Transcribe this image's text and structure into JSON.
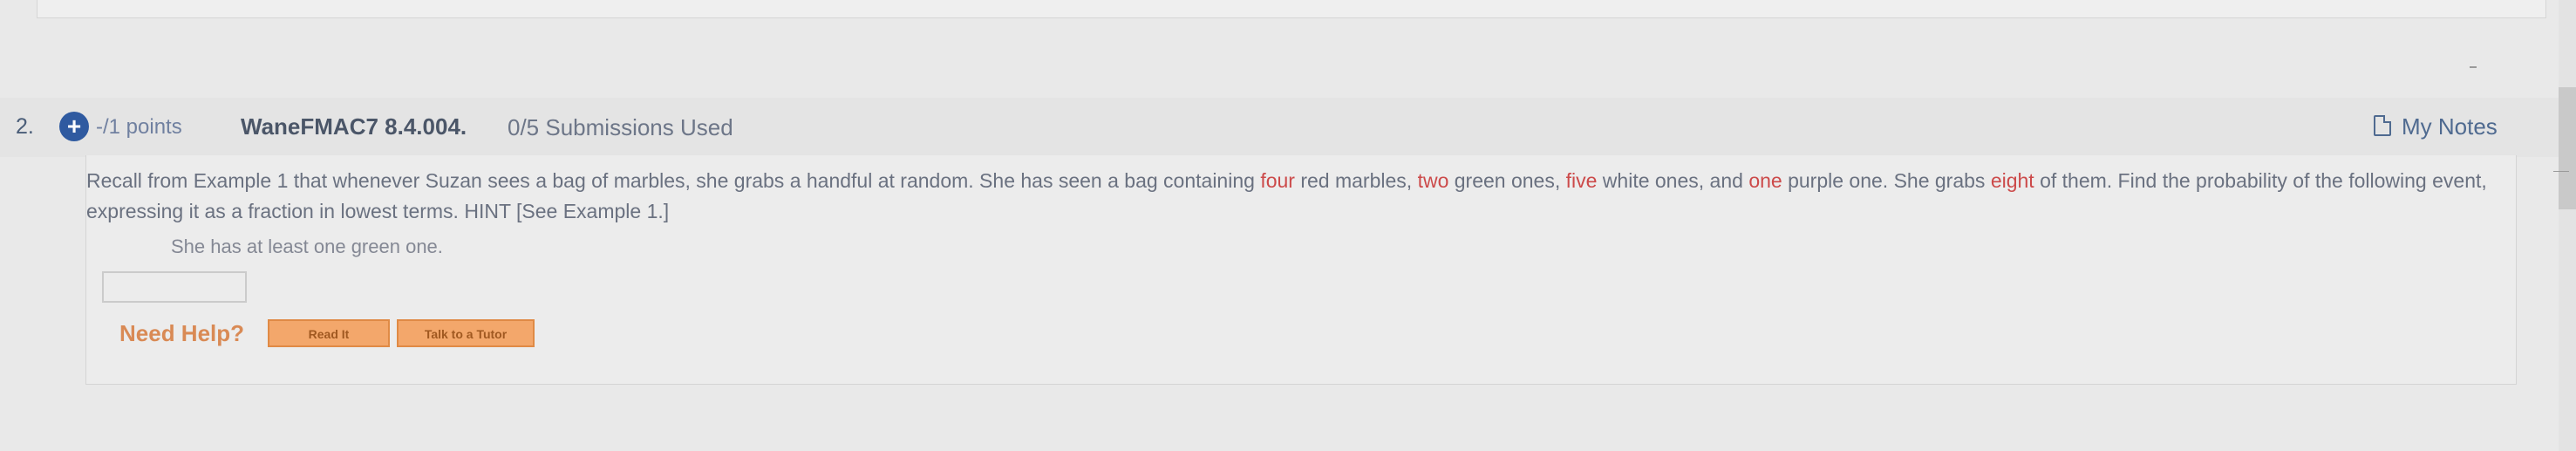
{
  "question": {
    "number": "2.",
    "points": "-/1 points",
    "id": "WaneFMAC7 8.4.004.",
    "submissions": "0/5 Submissions Used",
    "my_notes": "My Notes",
    "prompt": {
      "p1": "Recall from Example 1 that whenever Suzan sees a bag of marbles, she grabs a handful at random. She has seen a bag containing ",
      "four": "four",
      "p2": " red marbles, ",
      "two": "two",
      "p3": " green ones, ",
      "five": "five",
      "p4": " white ones, and ",
      "one": "one",
      "p5": " purple one. She grabs ",
      "eight": "eight",
      "p6": " of them. Find the probability of the following event, expressing it as a fraction in lowest terms. HINT ",
      "hint": "[See Example 1.]"
    },
    "sub_question": "She has at least one green one.",
    "answer_value": "",
    "need_help": "Need Help?",
    "read_it": "Read It",
    "talk_to_tutor": "Talk to a Tutor"
  },
  "colors": {
    "highlight": "#cc4a4a",
    "help_button": "#f3a76b",
    "icon_blue": "#2f5aa0"
  },
  "icons": {
    "expand": "plus-circle-icon",
    "notes": "note-document-icon"
  }
}
